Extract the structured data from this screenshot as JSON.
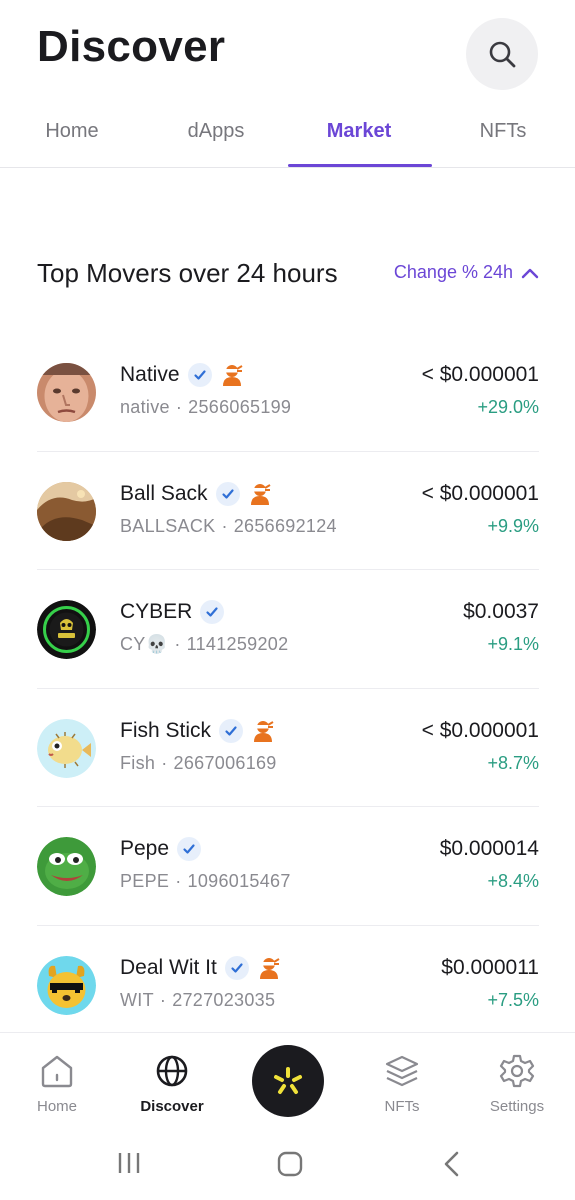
{
  "header": {
    "title": "Discover"
  },
  "tabs": [
    {
      "label": "Home"
    },
    {
      "label": "dApps"
    },
    {
      "label": "Market",
      "active": true
    },
    {
      "label": "NFTs"
    }
  ],
  "section": {
    "title": "Top Movers over 24 hours",
    "sort_label": "Change % 24h"
  },
  "movers": [
    {
      "name": "Native",
      "ticker": "native",
      "id": "2566065199",
      "price": "< $0.000001",
      "change": "+29.0%",
      "verified": true,
      "flagged": true,
      "avatar": "face-photo"
    },
    {
      "name": "Ball Sack",
      "ticker": "BALLSACK",
      "id": "2656692124",
      "price": "< $0.000001",
      "change": "+9.9%",
      "verified": true,
      "flagged": true,
      "avatar": "landscape-photo"
    },
    {
      "name": "CYBER",
      "ticker": "CY💀",
      "id": "1141259202",
      "price": "$0.0037",
      "change": "+9.1%",
      "verified": true,
      "flagged": false,
      "avatar": "cyber-skull-logo"
    },
    {
      "name": "Fish Stick",
      "ticker": "Fish",
      "id": "2667006169",
      "price": "< $0.000001",
      "change": "+8.7%",
      "verified": true,
      "flagged": true,
      "avatar": "pufferfish"
    },
    {
      "name": "Pepe",
      "ticker": "PEPE",
      "id": "1096015467",
      "price": "$0.000014",
      "change": "+8.4%",
      "verified": true,
      "flagged": false,
      "avatar": "pepe-frog"
    },
    {
      "name": "Deal Wit It",
      "ticker": "WIT",
      "id": "2727023035",
      "price": "$0.000011",
      "change": "+7.5%",
      "verified": true,
      "flagged": true,
      "avatar": "dog-sunglasses"
    }
  ],
  "bottom_nav": {
    "home": "Home",
    "discover": "Discover",
    "nfts": "NFTs",
    "settings": "Settings"
  },
  "colors": {
    "accent": "#6b46d6",
    "positive": "#2a9d82",
    "verified": "#2f6fd6",
    "flag": "#e8731f"
  }
}
